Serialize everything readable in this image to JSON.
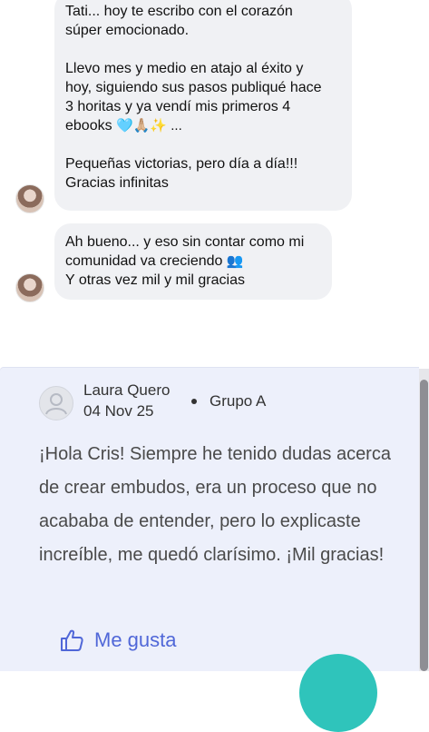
{
  "messages": [
    {
      "paragraphs": [
        "Tati... hoy te escribo con el corazón\nsúper emocionado.",
        "Llevo mes y medio en atajo al éxito y\nhoy, siguiendo sus pasos publiqué hace\n3 horitas y ya vendí mis primeros 4\nebooks",
        "Pequeñas victorias, pero día a día!!!\nGracias infinitas"
      ],
      "emoji_tail": "🩵🙏🏼✨ ..."
    },
    {
      "line1": "Ah bueno... y eso sin contar como mi",
      "line2": "comunidad va creciendo",
      "line2_emoji": "👥",
      "line3": "Y otras vez mil y mil gracias"
    }
  ],
  "comment": {
    "author": "Laura Quero",
    "date": "04 Nov 25",
    "group": "Grupo A",
    "text": "¡Hola Cris! Siempre he tenido dudas acerca de crear embudos, era un proceso que no acababa de entender, pero lo explicaste increíble, me quedó clarísimo. ¡Mil gracias!",
    "like_label": "Me gusta"
  },
  "colors": {
    "bubble": "#f0f1f4",
    "card": "#edf0fb",
    "like": "#5067d8",
    "fab": "#2fc4bb"
  }
}
